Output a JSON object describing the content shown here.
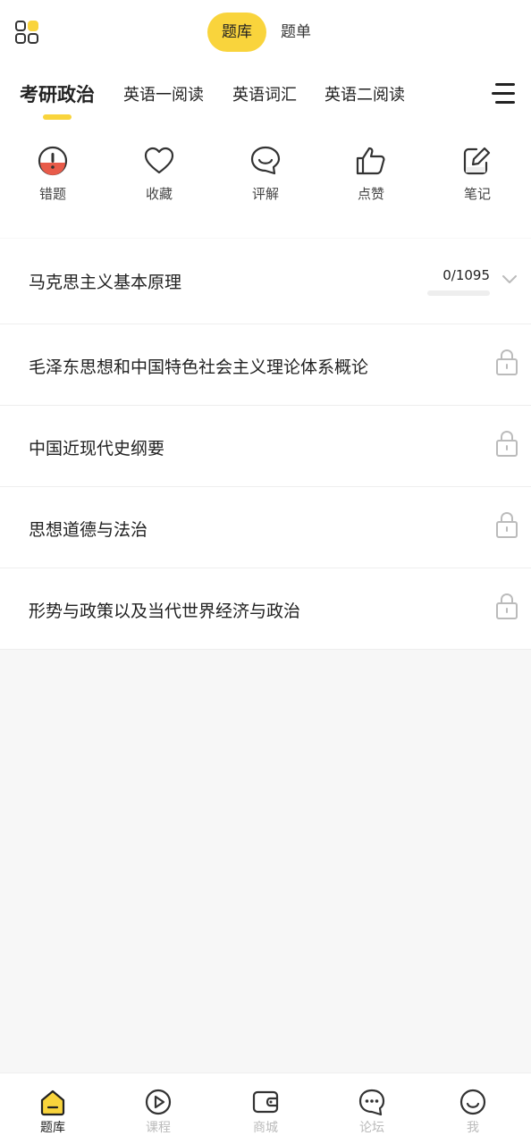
{
  "header": {
    "segments": [
      {
        "label": "题库",
        "active": true
      },
      {
        "label": "题单",
        "active": false
      }
    ]
  },
  "tabs": [
    {
      "label": "考研政治",
      "active": true
    },
    {
      "label": "英语一阅读",
      "active": false
    },
    {
      "label": "英语词汇",
      "active": false
    },
    {
      "label": "英语二阅读",
      "active": false
    }
  ],
  "actions": [
    {
      "label": "错题",
      "icon": "mistake-icon"
    },
    {
      "label": "收藏",
      "icon": "heart-icon"
    },
    {
      "label": "评解",
      "icon": "comment-icon"
    },
    {
      "label": "点赞",
      "icon": "thumbs-up-icon"
    },
    {
      "label": "笔记",
      "icon": "note-icon"
    }
  ],
  "subjects": [
    {
      "title": "马克思主义基本原理",
      "progress": "0/1095",
      "progress_fraction": 0,
      "locked": false
    },
    {
      "title": "毛泽东思想和中国特色社会主义理论体系概论",
      "locked": true
    },
    {
      "title": "中国近现代史纲要",
      "locked": true
    },
    {
      "title": "思想道德与法治",
      "locked": true
    },
    {
      "title": "形势与政策以及当代世界经济与政治",
      "locked": true
    }
  ],
  "bottom_nav": [
    {
      "label": "题库",
      "icon": "home-icon",
      "active": true
    },
    {
      "label": "课程",
      "icon": "play-icon",
      "active": false
    },
    {
      "label": "商城",
      "icon": "wallet-icon",
      "active": false
    },
    {
      "label": "论坛",
      "icon": "chat-icon",
      "active": false
    },
    {
      "label": "我",
      "icon": "smile-icon",
      "active": false
    }
  ],
  "colors": {
    "accent": "#f9d43c",
    "mistake_red": "#e85b4a"
  }
}
